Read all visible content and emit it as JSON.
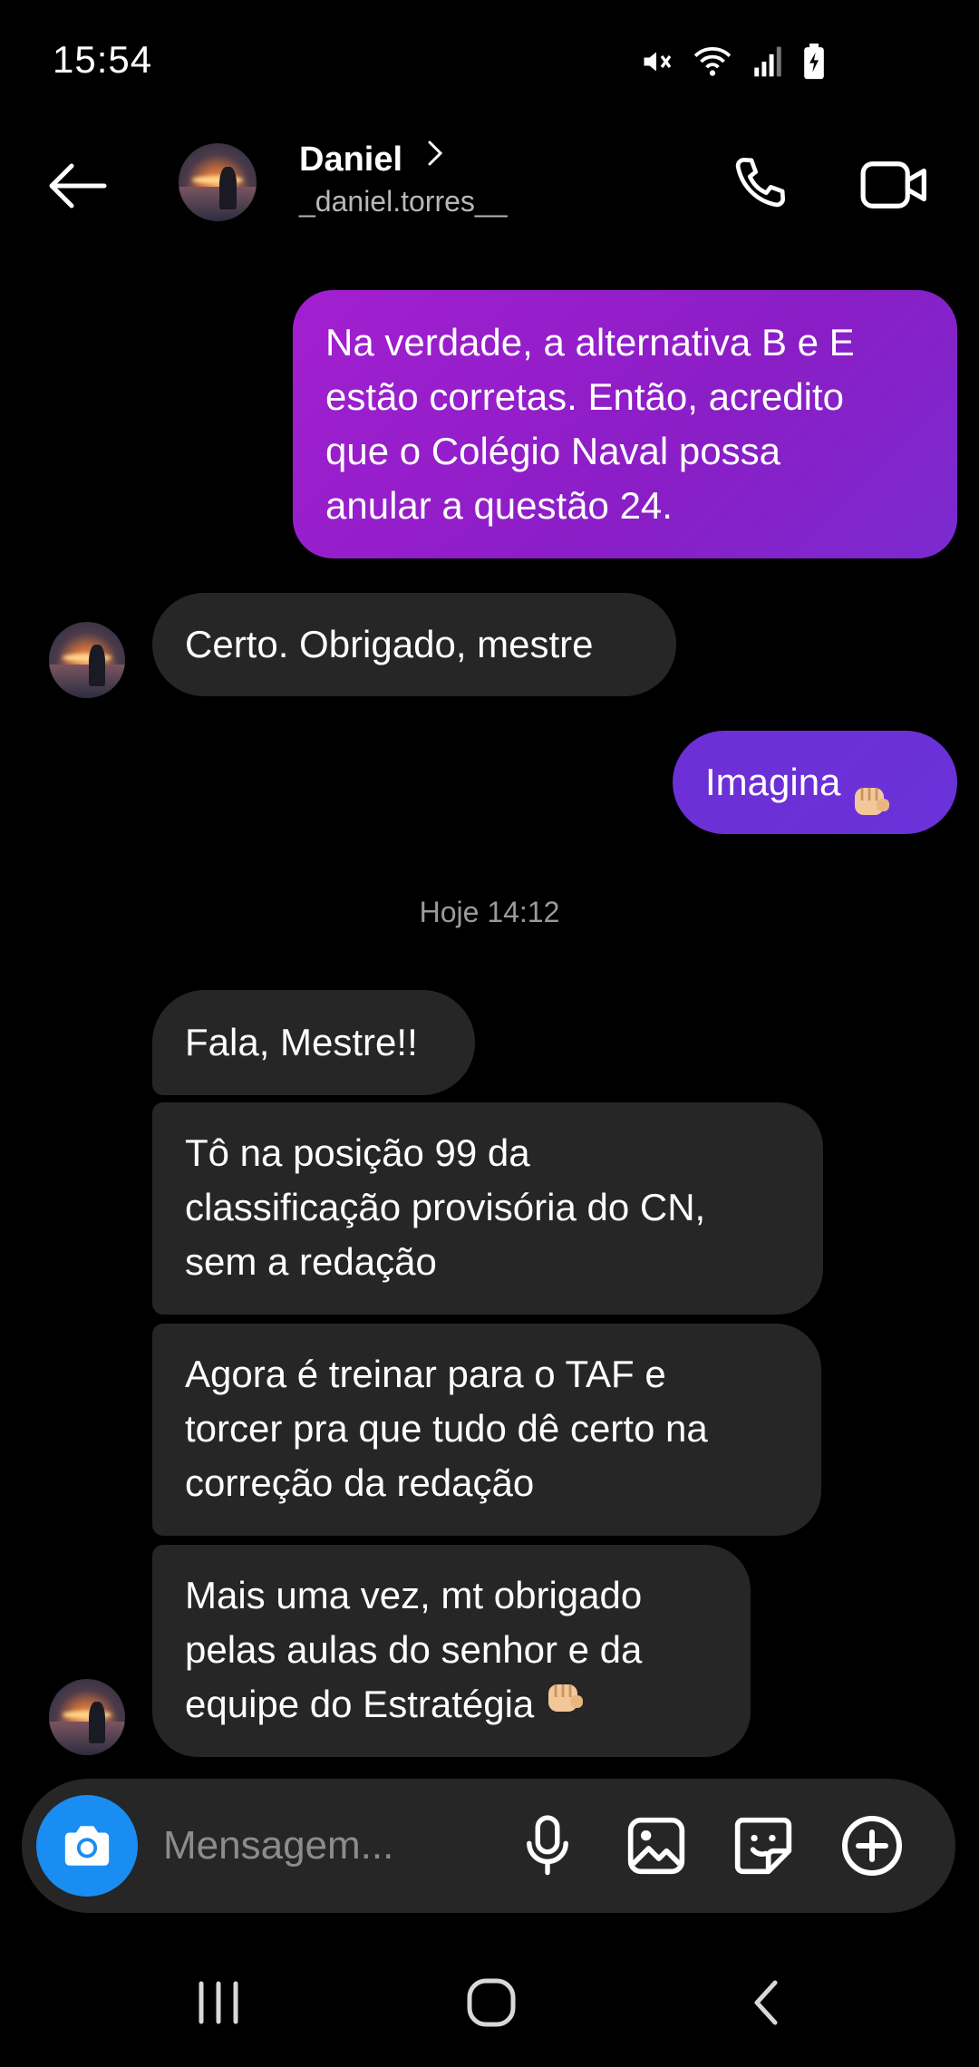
{
  "status_bar": {
    "time": "15:54",
    "icons": [
      "mute-icon",
      "wifi-icon",
      "signal-icon",
      "battery-charging-icon"
    ]
  },
  "header": {
    "name": "Daniel",
    "username": "_daniel.torres__",
    "icons": [
      "back-arrow-icon",
      "chevron-right-icon",
      "phone-icon",
      "video-camera-icon"
    ]
  },
  "messages": [
    {
      "direction": "sent",
      "text": "Na verdade, a alternativa B e E\nestão corretas. Então, acredito\nque o Colégio Naval possa\nanular a questão 24."
    },
    {
      "direction": "received",
      "text": "Certo. Obrigado, mestre"
    },
    {
      "direction": "sent",
      "text": "Imagina",
      "emoji": "fist-bump-icon"
    },
    {
      "direction": "received",
      "text": "Fala, Mestre!!"
    },
    {
      "direction": "received",
      "text": "Tô na posição 99 da\nclassificação provisória do CN,\nsem a redação"
    },
    {
      "direction": "received",
      "text": "Agora é treinar para o TAF e\ntorcer pra que tudo dê certo na\ncorreção da redação"
    },
    {
      "direction": "received",
      "text": "Mais uma vez, mt obrigado\npelas aulas do senhor e da\nequipe do Estratégia",
      "emoji": "fist-bump-icon"
    }
  ],
  "timestamp": "Hoje 14:12",
  "composer": {
    "placeholder": "Mensagem...",
    "icons": [
      "camera-icon",
      "microphone-icon",
      "gallery-icon",
      "sticker-icon",
      "plus-icon"
    ]
  },
  "colors": {
    "sent_bubble": "#8a1ec6",
    "sent_bubble_short": "#6a32d8",
    "received_bubble": "#262626",
    "camera_button": "#1a8df2",
    "background": "#000000"
  },
  "nav_bar": {
    "icons": [
      "recents-icon",
      "home-icon",
      "back-icon"
    ]
  }
}
